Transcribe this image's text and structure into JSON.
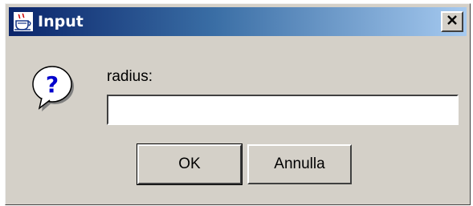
{
  "window": {
    "title": "Input",
    "title_icon": "java-cup-icon",
    "close_glyph": "✕"
  },
  "dialog": {
    "icon": "question-icon",
    "prompt": "radius:",
    "input_value": "",
    "input_placeholder": ""
  },
  "buttons": {
    "ok_label": "OK",
    "cancel_label": "Annulla"
  },
  "colors": {
    "titlebar_start": "#0a246a",
    "titlebar_end": "#a6caf0",
    "window_bg": "#d4d0c8"
  }
}
